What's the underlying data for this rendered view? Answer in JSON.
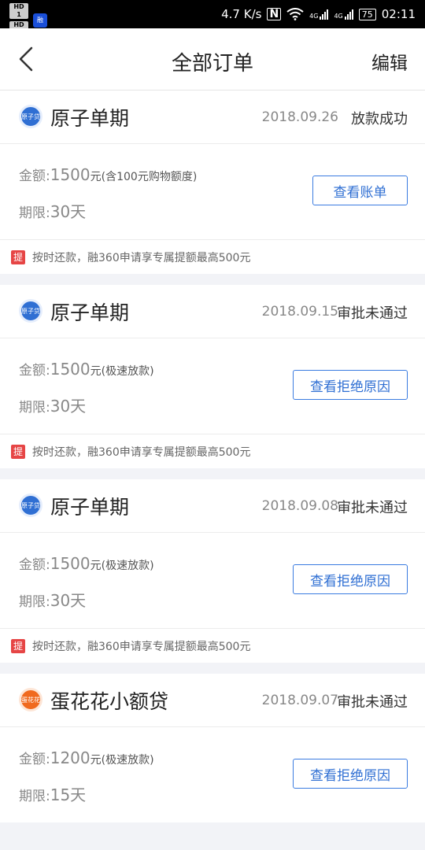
{
  "status_bar": {
    "hd1": "HD 1",
    "hd2": "HD 2",
    "net_speed": "4.7 K/s",
    "nfc": "N",
    "signal1": "4G",
    "signal2": "4G",
    "battery": "75",
    "time": "02:11"
  },
  "header": {
    "title": "全部订单",
    "edit_label": "编辑"
  },
  "orders": [
    {
      "logo_text": "原子贷",
      "product": "原子单期",
      "date": "2018.09.26",
      "status": "放款成功",
      "amount_label": "金额:",
      "amount_value": "1500",
      "amount_note": "元(含100元购物额度)",
      "term_label": "期限:",
      "term_value": "30天",
      "button": "查看账单",
      "tip_badge": "提",
      "tip": "按时还款，融360申请享专属提额最高500元"
    },
    {
      "logo_text": "原子贷",
      "product": "原子单期",
      "date": "2018.09.15",
      "status": "审批未通过",
      "amount_label": "金额:",
      "amount_value": "1500",
      "amount_note": "元(极速放款)",
      "term_label": "期限:",
      "term_value": "30天",
      "button": "查看拒绝原因",
      "tip_badge": "提",
      "tip": "按时还款，融360申请享专属提额最高500元"
    },
    {
      "logo_text": "原子贷",
      "product": "原子单期",
      "date": "2018.09.08",
      "status": "审批未通过",
      "amount_label": "金额:",
      "amount_value": "1500",
      "amount_note": "元(极速放款)",
      "term_label": "期限:",
      "term_value": "30天",
      "button": "查看拒绝原因",
      "tip_badge": "提",
      "tip": "按时还款，融360申请享专属提额最高500元"
    },
    {
      "logo_text": "蛋花花",
      "product": "蛋花花小额贷",
      "date": "2018.09.07",
      "status": "审批未通过",
      "amount_label": "金额:",
      "amount_value": "1200",
      "amount_note": "元(极速放款)",
      "term_label": "期限:",
      "term_value": "15天",
      "button": "查看拒绝原因"
    }
  ],
  "colors": {
    "accent": "#2f6fd3",
    "tip_badge": "#e64545",
    "background": "#f2f3f7"
  }
}
